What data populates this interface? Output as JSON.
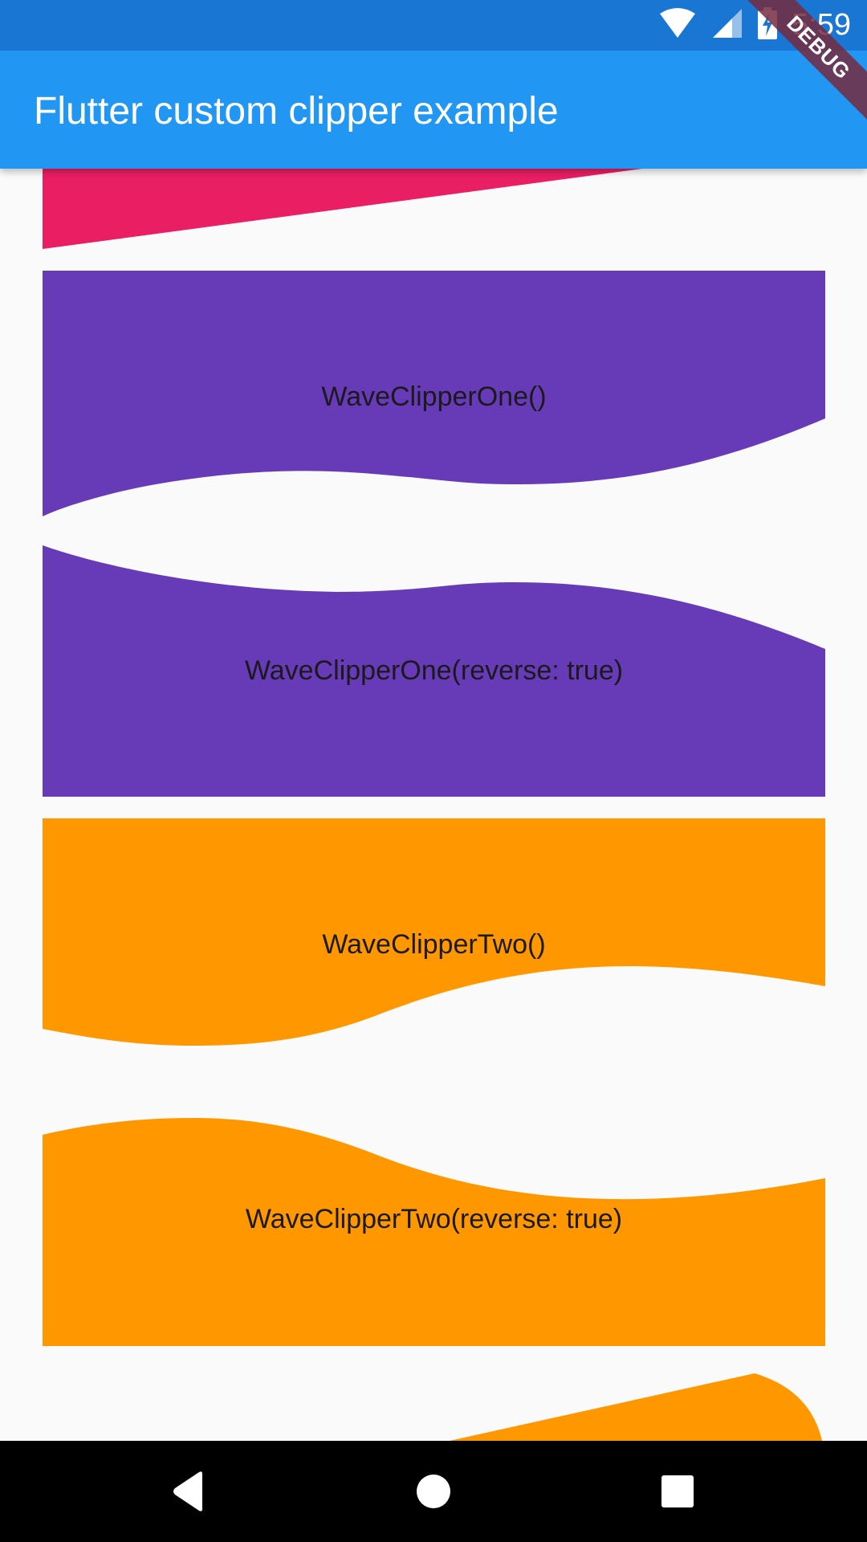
{
  "status_bar": {
    "time": "5:59",
    "icons": [
      "wifi-icon",
      "signal-icon",
      "battery-charging-icon"
    ],
    "debug_label": "DEBUG"
  },
  "app_bar": {
    "title": "Flutter custom clipper example"
  },
  "clippers": [
    {
      "label": "",
      "color": "#e91e63"
    },
    {
      "label": "WaveClipperOne()",
      "color": "#673ab7"
    },
    {
      "label": "WaveClipperOne(reverse: true)",
      "color": "#673ab7"
    },
    {
      "label": "WaveClipperTwo()",
      "color": "#ff9800"
    },
    {
      "label": "WaveClipperTwo(reverse: true)",
      "color": "#ff9800"
    },
    {
      "label": "",
      "color": "#ff9800"
    }
  ],
  "colors": {
    "status_bar": "#1976d2",
    "app_bar": "#2196f3",
    "background": "#fafafa",
    "nav_bar": "#000000"
  },
  "nav_bar": {
    "buttons": [
      "back-icon",
      "home-icon",
      "recents-icon"
    ]
  }
}
